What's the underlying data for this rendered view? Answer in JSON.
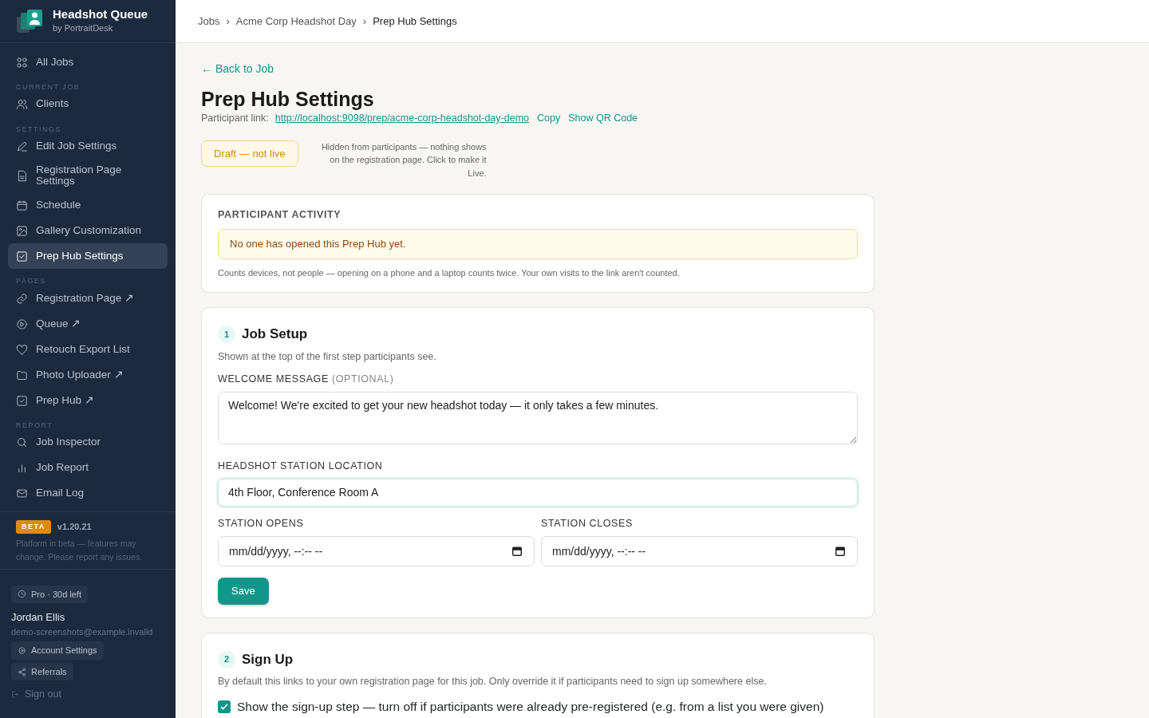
{
  "brand": {
    "title": "Headshot Queue",
    "subtitle": "by PortraitDesk"
  },
  "sidebar": {
    "sections": [
      {
        "items": [
          {
            "label": "All Jobs",
            "selected": false
          }
        ]
      },
      {
        "heading": "CURRENT JOB",
        "items": [
          {
            "label": "Clients",
            "selected": false
          }
        ]
      },
      {
        "heading": "SETTINGS",
        "items": [
          {
            "label": "Edit Job Settings",
            "selected": false
          },
          {
            "label": "Registration Page Settings",
            "selected": false
          },
          {
            "label": "Schedule",
            "selected": false
          },
          {
            "label": "Gallery Customization",
            "selected": false
          },
          {
            "label": "Prep Hub Settings",
            "selected": true
          }
        ]
      },
      {
        "heading": "PAGES",
        "items": [
          {
            "label": "Registration Page ↗",
            "selected": false
          },
          {
            "label": "Queue ↗",
            "selected": false
          },
          {
            "label": "Retouch Export List",
            "selected": false
          },
          {
            "label": "Photo Uploader ↗",
            "selected": false
          },
          {
            "label": "Prep Hub ↗",
            "selected": false
          }
        ]
      },
      {
        "heading": "REPORT",
        "items": [
          {
            "label": "Job Inspector",
            "selected": false
          },
          {
            "label": "Job Report",
            "selected": false
          },
          {
            "label": "Email Log",
            "selected": false
          }
        ]
      }
    ],
    "beta": {
      "badge": "BETA",
      "version": "v1.20.21",
      "note": "Platform in beta — features may change. Please report any issues."
    },
    "user": {
      "plan": "Pro · 30d left",
      "name": "Jordan Ellis",
      "email": "demo-screenshots@example.invalid",
      "buttons": [
        "Account Settings",
        "Referrals"
      ],
      "sign_out": "Sign out"
    }
  },
  "breadcrumb": [
    {
      "kind": "link",
      "text": "Jobs"
    },
    {
      "kind": "separator",
      "text": "›"
    },
    {
      "kind": "link",
      "text": "Acme Corp Headshot Day"
    },
    {
      "kind": "separator",
      "text": "›"
    },
    {
      "kind": "current",
      "text": "Prep Hub Settings"
    }
  ],
  "back_link": "← Back to Job",
  "title": "Prep Hub Settings",
  "participant_link": {
    "label": "Participant link:",
    "url": "http://localhost:9098/prep/acme-corp-headshot-day-demo",
    "actions": [
      "Copy",
      "Show QR Code"
    ]
  },
  "status": {
    "button": "Draft — not live",
    "hint": "Hidden from participants — nothing shows on the registration page. Click to make it Live."
  },
  "activity": {
    "heading": "PARTICIPANT ACTIVITY",
    "alert": "No one has opened this Prep Hub yet.",
    "note": "Counts devices, not people — opening on a phone and a laptop counts twice. Your own visits to the link aren't counted."
  },
  "steps": [
    {
      "number": "1",
      "title": "Job Setup",
      "description": "Shown at the top of the first step participants see.",
      "welcome": {
        "label": "WELCOME MESSAGE",
        "optional": "(OPTIONAL)",
        "value": "Welcome! We're excited to get your new headshot today — it only takes a few minutes."
      },
      "location": {
        "label": "HEADSHOT STATION LOCATION",
        "value": "4th Floor, Conference Room A",
        "focused": true
      },
      "times": [
        {
          "label": "STATION OPENS",
          "placeholder": "mm/dd/yyyy, --:-- --"
        },
        {
          "label": "STATION CLOSES",
          "placeholder": "mm/dd/yyyy, --:-- --"
        }
      ],
      "save": "Save"
    },
    {
      "number": "2",
      "title": "Sign Up",
      "description": "By default this links to your own registration page for this job. Only override it if participants need to sign up somewhere else.",
      "checkbox": {
        "label": "Show the sign-up step — turn off if participants were already pre-registered (e.g. from a list you were given)",
        "checked": true
      }
    }
  ]
}
